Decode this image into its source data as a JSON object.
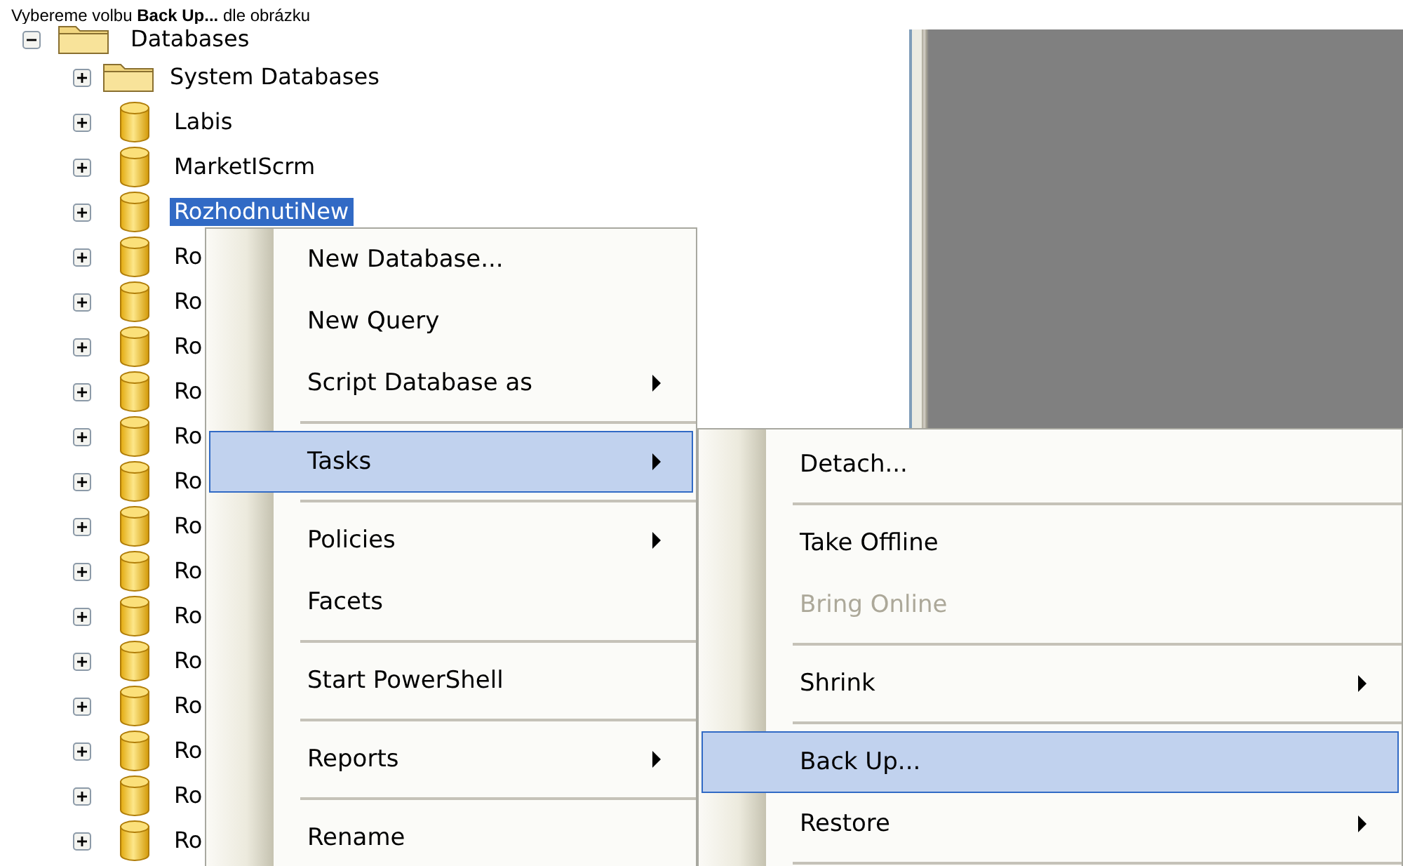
{
  "caption": {
    "text": "Vybereme volbu **Back Up...** dle obrázku"
  },
  "tree": {
    "label": "Databases",
    "expanded": true,
    "children": [
      {
        "label": "System Databases",
        "kind": "folder",
        "expanded": false,
        "selected": false
      },
      {
        "label": "Labis",
        "kind": "database",
        "expanded": false,
        "selected": false
      },
      {
        "label": "MarketIScrm",
        "kind": "database",
        "expanded": false,
        "selected": false
      },
      {
        "label": "RozhodnutiNew",
        "kind": "database",
        "expanded": false,
        "selected": true
      },
      {
        "label": "Ro",
        "kind": "database",
        "expanded": false,
        "selected": false
      },
      {
        "label": "Ro",
        "kind": "database",
        "expanded": false,
        "selected": false
      },
      {
        "label": "Ro",
        "kind": "database",
        "expanded": false,
        "selected": false
      },
      {
        "label": "Ro",
        "kind": "database",
        "expanded": false,
        "selected": false
      },
      {
        "label": "Ro",
        "kind": "database",
        "expanded": false,
        "selected": false
      },
      {
        "label": "Ro",
        "kind": "database",
        "expanded": false,
        "selected": false
      },
      {
        "label": "Ro",
        "kind": "database",
        "expanded": false,
        "selected": false
      },
      {
        "label": "Ro",
        "kind": "database",
        "expanded": false,
        "selected": false
      },
      {
        "label": "Ro",
        "kind": "database",
        "expanded": false,
        "selected": false
      },
      {
        "label": "Ro",
        "kind": "database",
        "expanded": false,
        "selected": false
      },
      {
        "label": "Ro",
        "kind": "database",
        "expanded": false,
        "selected": false
      },
      {
        "label": "Ro",
        "kind": "database",
        "expanded": false,
        "selected": false
      },
      {
        "label": "Ro",
        "kind": "database",
        "expanded": false,
        "selected": false
      },
      {
        "label": "Ro",
        "kind": "database",
        "expanded": false,
        "selected": false
      }
    ]
  },
  "context_menu": {
    "items": [
      {
        "kind": "item",
        "label": "New Database...",
        "submenu": false,
        "selected": false,
        "disabled": false
      },
      {
        "kind": "item",
        "label": "New Query",
        "submenu": false,
        "selected": false,
        "disabled": false
      },
      {
        "kind": "item",
        "label": "Script Database as",
        "submenu": true,
        "selected": false,
        "disabled": false
      },
      {
        "kind": "separator"
      },
      {
        "kind": "item",
        "label": "Tasks",
        "submenu": true,
        "selected": true,
        "disabled": false
      },
      {
        "kind": "separator"
      },
      {
        "kind": "item",
        "label": "Policies",
        "submenu": true,
        "selected": false,
        "disabled": false
      },
      {
        "kind": "item",
        "label": "Facets",
        "submenu": false,
        "selected": false,
        "disabled": false
      },
      {
        "kind": "separator"
      },
      {
        "kind": "item",
        "label": "Start PowerShell",
        "submenu": false,
        "selected": false,
        "disabled": false
      },
      {
        "kind": "separator"
      },
      {
        "kind": "item",
        "label": "Reports",
        "submenu": true,
        "selected": false,
        "disabled": false
      },
      {
        "kind": "separator"
      },
      {
        "kind": "item",
        "label": "Rename",
        "submenu": false,
        "selected": false,
        "disabled": false
      }
    ]
  },
  "tasks_submenu": {
    "items": [
      {
        "kind": "item",
        "label": "Detach...",
        "submenu": false,
        "selected": false,
        "disabled": false
      },
      {
        "kind": "separator"
      },
      {
        "kind": "item",
        "label": "Take Offline",
        "submenu": false,
        "selected": false,
        "disabled": false
      },
      {
        "kind": "item",
        "label": "Bring Online",
        "submenu": false,
        "selected": false,
        "disabled": true
      },
      {
        "kind": "separator"
      },
      {
        "kind": "item",
        "label": "Shrink",
        "submenu": true,
        "selected": false,
        "disabled": false
      },
      {
        "kind": "separator"
      },
      {
        "kind": "item",
        "label": "Back Up...",
        "submenu": false,
        "selected": true,
        "disabled": false
      },
      {
        "kind": "item",
        "label": "Restore",
        "submenu": true,
        "selected": false,
        "disabled": false
      },
      {
        "kind": "separator"
      }
    ]
  }
}
